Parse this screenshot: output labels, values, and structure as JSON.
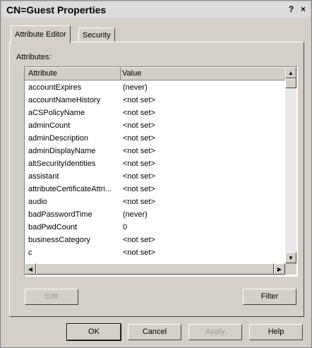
{
  "window": {
    "title": "CN=Guest Properties",
    "help_label": "?",
    "close_label": "×"
  },
  "tabs": [
    {
      "label": "Attribute Editor",
      "active": true
    },
    {
      "label": "Security",
      "active": false
    }
  ],
  "attributes_label": "Attributes:",
  "table": {
    "columns": [
      "Attribute",
      "Value"
    ],
    "rows": [
      {
        "attribute": "accountExpires",
        "value": "(never)"
      },
      {
        "attribute": "accountNameHistory",
        "value": "<not set>"
      },
      {
        "attribute": "aCSPolicyName",
        "value": "<not set>"
      },
      {
        "attribute": "adminCount",
        "value": "<not set>"
      },
      {
        "attribute": "adminDescription",
        "value": "<not set>"
      },
      {
        "attribute": "adminDisplayName",
        "value": "<not set>"
      },
      {
        "attribute": "altSecurityIdentities",
        "value": "<not set>"
      },
      {
        "attribute": "assistant",
        "value": "<not set>"
      },
      {
        "attribute": "attributeCertificateAttri...",
        "value": "<not set>"
      },
      {
        "attribute": "audio",
        "value": "<not set>"
      },
      {
        "attribute": "badPasswordTime",
        "value": "(never)"
      },
      {
        "attribute": "badPwdCount",
        "value": "0"
      },
      {
        "attribute": "businessCategory",
        "value": "<not set>"
      },
      {
        "attribute": "c",
        "value": "<not set>"
      }
    ]
  },
  "buttons": {
    "edit": "Edit",
    "filter": "Filter",
    "ok": "OK",
    "cancel": "Cancel",
    "apply": "Apply",
    "help": "Help"
  },
  "icons": {
    "scroll_up": "▲",
    "scroll_down": "▼",
    "scroll_left": "◀",
    "scroll_right": "▶"
  }
}
